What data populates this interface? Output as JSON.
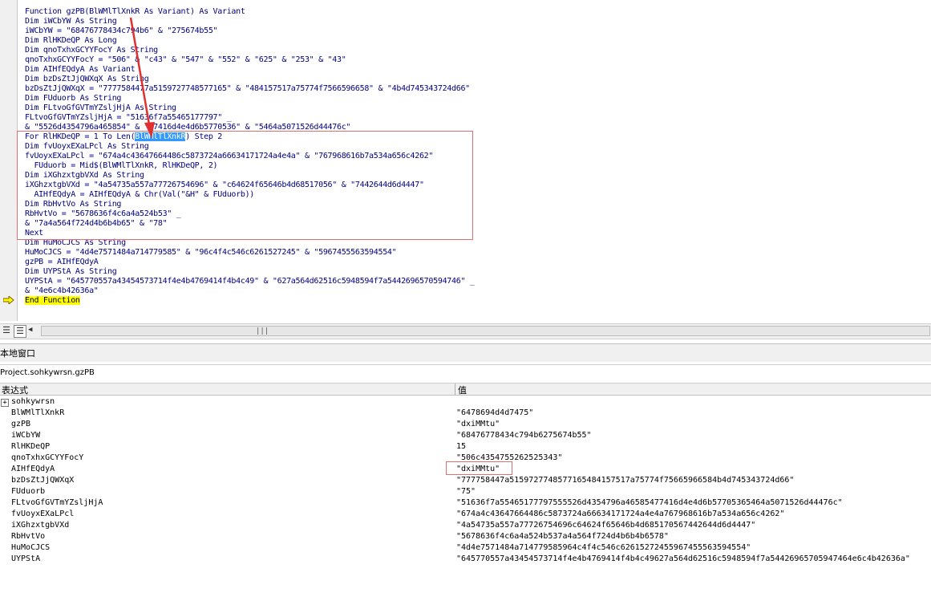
{
  "code": {
    "lines": [
      "Function gzPB(BlWMlTlXnkR As Variant) As Variant",
      "Dim iWCbYW As String",
      "iWCbYW = \"68476778434c794b6\" & \"275674b55\"",
      "Dim RlHKDeQP As Long",
      "Dim qnoTxhxGCYYFocY As String",
      "qnoTxhxGCYYFocY = \"506\" & \"c43\" & \"547\" & \"552\" & \"625\" & \"253\" & \"43\"",
      "Dim AIHfEQdyA As Variant",
      "Dim bzDsZtJjQWXqX As String",
      "bzDsZtJjQWXqX = \"7777584477a5159727748577165\" & \"484157517a75774f7566596658\" & \"4b4d745343724d66\"",
      "Dim FUduorb As String",
      "Dim FLtvoGfGVTmYZsljHjA As String",
      "FLtvoGfGVTmYZsljHjA = \"51636f7a55465177797\" _",
      "& \"5526d4354796a465854\" & \"77416d4e4d6b5770536\" & \"5464a5071526d44476c\"",
      "For RlHKDeQP = 1 To Len(|BlWMlTlXnkR|) Step 2",
      "Dim fvUoyxEXaLPcl As String",
      "fvUoyxEXaLPcl = \"674a4c43647664486c5873724a66634171724a4e4a\" & \"767968616b7a534a656c4262\"",
      "  FUduorb = Mid$(BlWMlTlXnkR, RlHKDeQP, 2)",
      "Dim iXGhzxtgbVXd As String",
      "iXGhzxtgbVXd = \"4a54735a557a77726754696\" & \"c64624f65646b4d68517056\" & \"7442644d6d4447\"",
      "  AIHfEQdyA = AIHfEQdyA & Chr(Val(\"&H\" & FUduorb))",
      "Dim RbHvtVo As String",
      "RbHvtVo = \"5678636f4c6a4a524b53\" _",
      "& \"7a4a564f724d4b6b4b65\" & \"78\"",
      "Next",
      "Dim HuMoCJCS As String",
      "HuMoCJCS = \"4d4e7571484a714779585\" & \"96c4f4c546c6261527245\" & \"5967455563594554\"",
      "gzPB = AIHfEQdyA",
      "Dim UYPStA As String",
      "UYPStA = \"645770557a43454573714f4e4b4769414f4b4c49\" & \"627a564d62516c5948594f7a5442696570594746\" _",
      "& \"4e6c4b42636a\"",
      "End Function"
    ]
  },
  "locals_window": {
    "title": "本地窗口",
    "procedure": "Project.sohkywrsn.gzPB",
    "col_expression": "表达式",
    "col_value": "值",
    "rows": [
      {
        "expr": "sohkywrsn",
        "val": ""
      },
      {
        "expr": "BlWMlTlXnkR",
        "val": "\"6478694d4d7475\""
      },
      {
        "expr": "gzPB",
        "val": "\"dxiMMtu\""
      },
      {
        "expr": "iWCbYW",
        "val": "\"68476778434c794b6275674b55\""
      },
      {
        "expr": "RlHKDeQP",
        "val": "15"
      },
      {
        "expr": "qnoTxhxGCYYFocY",
        "val": "\"506c4354755262525343\""
      },
      {
        "expr": "AIHfEQdyA",
        "val": "\"dxiMMtu\""
      },
      {
        "expr": "bzDsZtJjQWXqX",
        "val": "\"777758447a5159727748577165484157517a75774f75665966584b4d745343724d66\""
      },
      {
        "expr": "FUduorb",
        "val": "\"75\""
      },
      {
        "expr": "FLtvoGfGVTmYZsljHjA",
        "val": "\"51636f7a55465177797555526d4354796a46585477416d4e4d6b57705365464a5071526d44476c\""
      },
      {
        "expr": "fvUoyxEXaLPcl",
        "val": "\"674a4c43647664486c5873724a66634171724a4e4a767968616b7a534a656c4262\""
      },
      {
        "expr": "iXGhzxtgbVXd",
        "val": "\"4a54735a557a77726754696c64624f65646b4d685170567442644d6d4447\""
      },
      {
        "expr": "RbHvtVo",
        "val": "\"5678636f4c6a4a524b537a4a564f724d4b6b4b6578\""
      },
      {
        "expr": "HuMoCJCS",
        "val": "\"4d4e7571484a714779585964c4f4c546c62615272455967455563594554\""
      },
      {
        "expr": "UYPStA",
        "val": "\"645770557a43454573714f4e4b4769414f4b4c49627a564d62516c5948594f7a54426965705947464e6c4b42636a\""
      }
    ]
  },
  "colors": {
    "keyword": "#000080",
    "annotation": "#e03030",
    "exec_line": "#ffff00",
    "selection": "#3399ff"
  }
}
